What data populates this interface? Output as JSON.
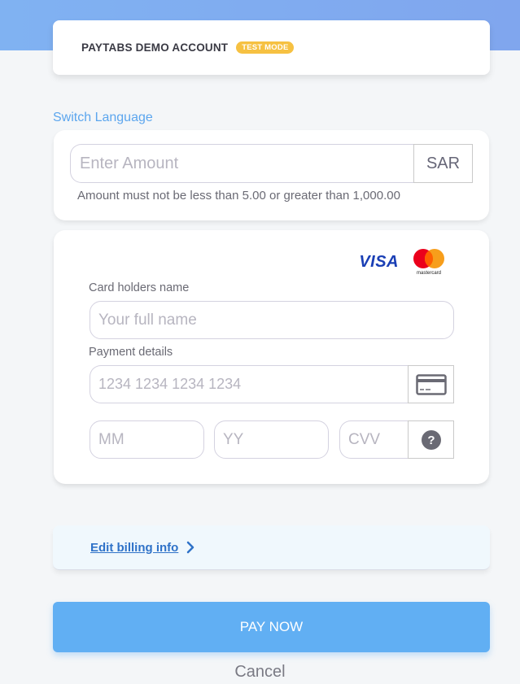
{
  "header": {
    "merchant_name": "PAYTABS DEMO ACCOUNT",
    "mode_badge": "TEST MODE",
    "badge_color": "#f6c142"
  },
  "switch_language": "Switch Language",
  "amount": {
    "placeholder": "Enter Amount",
    "value": "",
    "currency": "SAR",
    "hint": "Amount must not be less than 5.00 or greater than 1,000.00"
  },
  "card_form": {
    "brands": [
      "VISA",
      "mastercard"
    ],
    "holder_label": "Card holders name",
    "holder_placeholder": "Your full name",
    "payment_label": "Payment details",
    "card_number_placeholder": "1234 1234 1234 1234",
    "card_icon": "credit-card-icon",
    "month_placeholder": "MM",
    "year_placeholder": "YY",
    "cvv_placeholder": "CVV",
    "cvv_help_icon": "question-icon"
  },
  "billing": {
    "link_label": "Edit billing info",
    "icon": "chevron-right-icon"
  },
  "actions": {
    "pay_label": "PAY NOW",
    "cancel_label": "Cancel",
    "pay_color": "#61aff3"
  }
}
